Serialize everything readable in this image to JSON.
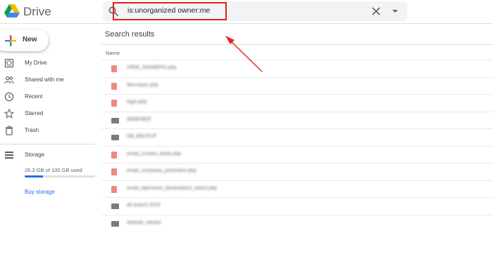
{
  "app": {
    "name": "Drive"
  },
  "search": {
    "value": "is:unorganized owner:me"
  },
  "new_button": {
    "label": "New"
  },
  "sidebar": {
    "items": [
      {
        "label": "My Drive",
        "icon": "my-drive-icon"
      },
      {
        "label": "Shared with me",
        "icon": "shared-icon"
      },
      {
        "label": "Recent",
        "icon": "clock-icon"
      },
      {
        "label": "Starred",
        "icon": "star-icon"
      },
      {
        "label": "Trash",
        "icon": "trash-icon"
      }
    ],
    "storage": {
      "label": "Storage",
      "usage_text": "26.3 GB of 100 GB used",
      "used_fraction": 0.263,
      "buy_label": "Buy storage"
    }
  },
  "main": {
    "title": "Search results",
    "column_name": "Name",
    "files": [
      {
        "name": "VIEW_SHAREFIX.php",
        "type": "doc"
      },
      {
        "name": "files-basic.php",
        "type": "doc"
      },
      {
        "name": "login.php",
        "type": "doc"
      },
      {
        "name": "WEBFREE",
        "type": "folder"
      },
      {
        "name": "DB_BACKUP",
        "type": "folder"
      },
      {
        "name": "email_cruises_deals.php",
        "type": "doc"
      },
      {
        "name": "email_cruisesas_promotion.php",
        "type": "doc"
      },
      {
        "name": "email_openseas_destinations_select.php",
        "type": "doc"
      },
      {
        "name": "all search 2016",
        "type": "folder"
      },
      {
        "name": "website_tracker",
        "type": "folder"
      }
    ]
  },
  "colors": {
    "highlight": "#e2231a",
    "accent": "#1a73e8",
    "doc_icon": "#ee8a7e",
    "folder_icon": "#7b7b7b"
  }
}
